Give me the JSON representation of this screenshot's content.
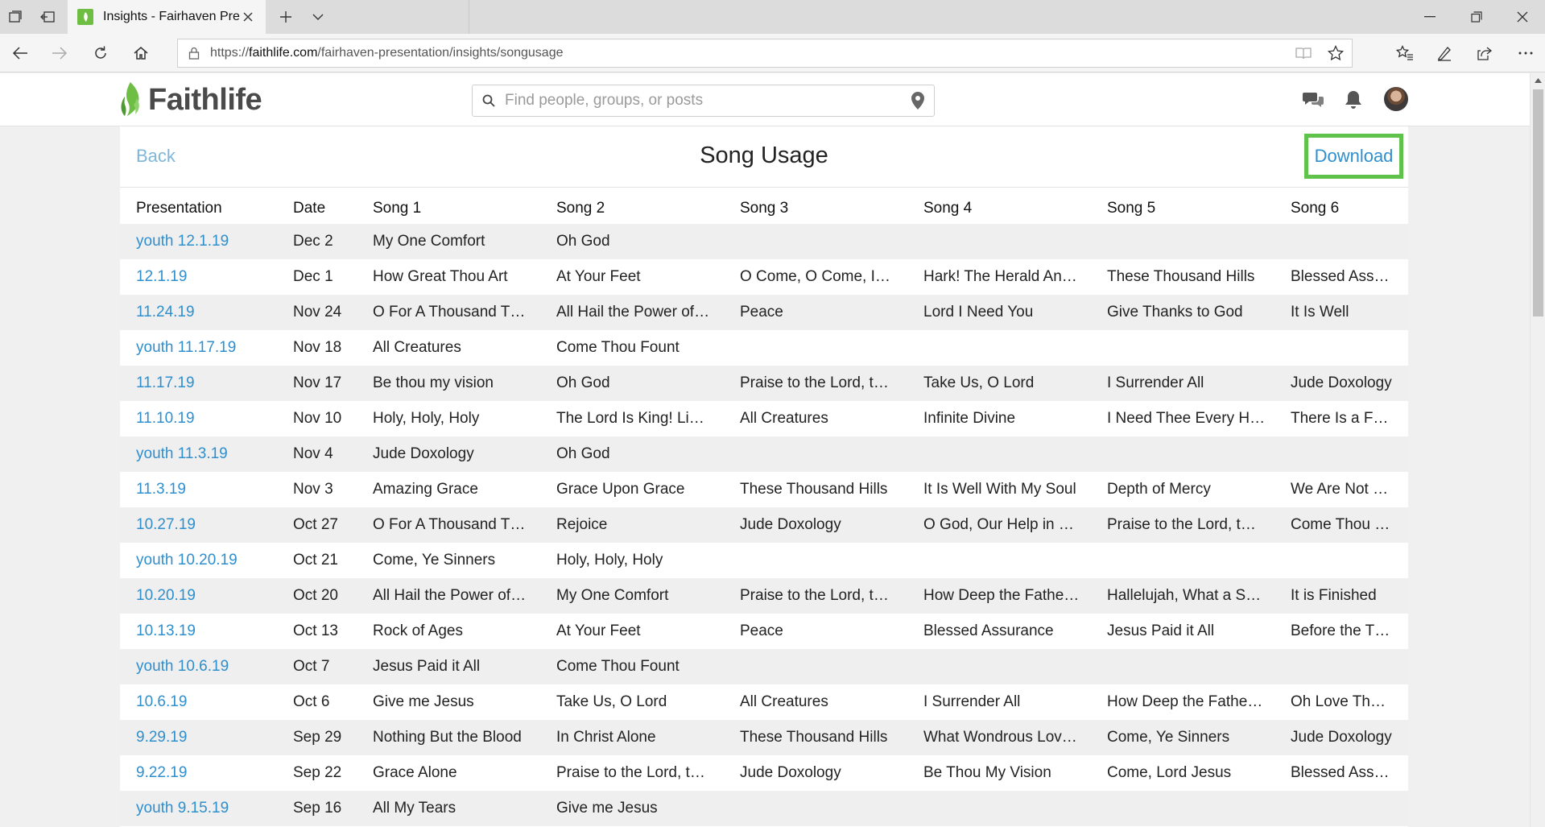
{
  "browser": {
    "tab_title": "Insights - Fairhaven Pre:",
    "url_prefix": "https://",
    "url_domain": "faithlife.com",
    "url_path": "/fairhaven-presentation/insights/songusage"
  },
  "header": {
    "logo_text": "Faithlife",
    "search_placeholder": "Find people, groups, or posts"
  },
  "page": {
    "back_label": "Back",
    "title": "Song Usage",
    "download_label": "Download"
  },
  "colors": {
    "accent": "#2e8fce",
    "download_highlight": "#5fc34b",
    "brand_green": "#6fbe44"
  },
  "table": {
    "columns": [
      "Presentation",
      "Date",
      "Song 1",
      "Song 2",
      "Song 3",
      "Song 4",
      "Song 5",
      "Song 6"
    ],
    "rows": [
      {
        "presentation": "youth 12.1.19",
        "date": "Dec 2",
        "songs": [
          "My One Comfort",
          "Oh God",
          "",
          "",
          "",
          ""
        ]
      },
      {
        "presentation": "12.1.19",
        "date": "Dec 1",
        "songs": [
          "How Great Thou Art",
          "At Your Feet",
          "O Come, O Come, I…",
          "Hark! The Herald An…",
          "These Thousand Hills",
          "Blessed Assuran"
        ]
      },
      {
        "presentation": "11.24.19",
        "date": "Nov 24",
        "songs": [
          "O For A Thousand T…",
          "All Hail the Power of…",
          "Peace",
          "Lord I Need You",
          "Give Thanks to God",
          "It Is Well"
        ]
      },
      {
        "presentation": "youth 11.17.19",
        "date": "Nov 18",
        "songs": [
          "All Creatures",
          "Come Thou Fount",
          "",
          "",
          "",
          ""
        ]
      },
      {
        "presentation": "11.17.19",
        "date": "Nov 17",
        "songs": [
          "Be thou my vision",
          "Oh God",
          "Praise to the Lord, t…",
          "Take Us, O Lord",
          "I Surrender All",
          "Jude Doxology"
        ]
      },
      {
        "presentation": "11.10.19",
        "date": "Nov 10",
        "songs": [
          "Holy, Holy, Holy",
          "The Lord Is King! Li…",
          "All Creatures",
          "Infinite Divine",
          "I Need Thee Every H…",
          "There Is a Fount"
        ]
      },
      {
        "presentation": "youth 11.3.19",
        "date": "Nov 4",
        "songs": [
          "Jude Doxology",
          "Oh God",
          "",
          "",
          "",
          ""
        ]
      },
      {
        "presentation": "11.3.19",
        "date": "Nov 3",
        "songs": [
          "Amazing Grace",
          "Grace Upon Grace",
          "These Thousand Hills",
          "It Is Well With My Soul",
          "Depth of Mercy",
          "We Are Not Ove"
        ]
      },
      {
        "presentation": "10.27.19",
        "date": "Oct 27",
        "songs": [
          "O For A Thousand T…",
          "Rejoice",
          "Jude Doxology",
          "O God, Our Help in …",
          "Praise to the Lord, t…",
          "Come Thou Fou"
        ]
      },
      {
        "presentation": "youth 10.20.19",
        "date": "Oct 21",
        "songs": [
          "Come, Ye Sinners",
          "Holy, Holy, Holy",
          "",
          "",
          "",
          ""
        ]
      },
      {
        "presentation": "10.20.19",
        "date": "Oct 20",
        "songs": [
          "All Hail the Power of…",
          "My One Comfort",
          "Praise to the Lord, t…",
          "How Deep the Fathe…",
          "Hallelujah, What a S…",
          "It is Finished"
        ]
      },
      {
        "presentation": "10.13.19",
        "date": "Oct 13",
        "songs": [
          "Rock of Ages",
          "At Your Feet",
          "Peace",
          "Blessed Assurance",
          "Jesus Paid it All",
          "Before the Thro"
        ]
      },
      {
        "presentation": "youth 10.6.19",
        "date": "Oct 7",
        "songs": [
          "Jesus Paid it All",
          "Come Thou Fount",
          "",
          "",
          "",
          ""
        ]
      },
      {
        "presentation": "10.6.19",
        "date": "Oct 6",
        "songs": [
          "Give me Jesus",
          "Take Us, O Lord",
          "All Creatures",
          "I Surrender All",
          "How Deep the Fathe…",
          "Oh Love That W"
        ]
      },
      {
        "presentation": "9.29.19",
        "date": "Sep 29",
        "songs": [
          "Nothing But the Blood",
          "In Christ Alone",
          "These Thousand Hills",
          "What Wondrous Lov…",
          "Come, Ye Sinners",
          "Jude Doxology"
        ]
      },
      {
        "presentation": "9.22.19",
        "date": "Sep 22",
        "songs": [
          "Grace Alone",
          "Praise to the Lord, t…",
          "Jude Doxology",
          "Be Thou My Vision",
          "Come, Lord Jesus",
          "Blessed Assuran"
        ]
      },
      {
        "presentation": "youth 9.15.19",
        "date": "Sep 16",
        "songs": [
          "All My Tears",
          "Give me Jesus",
          "",
          "",
          "",
          ""
        ]
      }
    ]
  }
}
